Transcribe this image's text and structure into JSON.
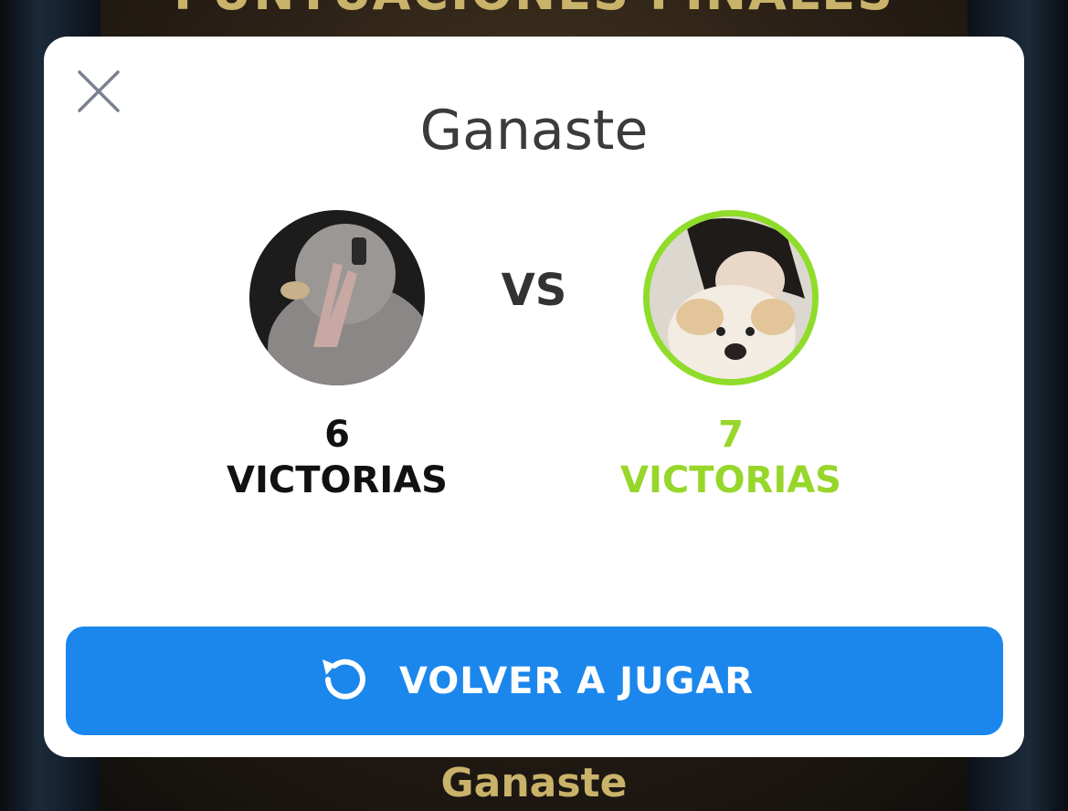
{
  "background": {
    "title": "PUNTUACIONES FINALES",
    "footer": "Ganaste"
  },
  "modal": {
    "title": "Ganaste",
    "vs_label": "VS",
    "player_left": {
      "wins": "6",
      "wins_label": "VICTORIAS"
    },
    "player_right": {
      "wins": "7",
      "wins_label": "VICTORIAS"
    },
    "replay_button": {
      "label": "VOLVER A JUGAR",
      "icon": "replay-icon"
    },
    "close_icon": "close-icon"
  },
  "colors": {
    "accent_green": "#97d62a",
    "button_blue": "#1b87ec",
    "background_gold": "#c9b36a"
  }
}
